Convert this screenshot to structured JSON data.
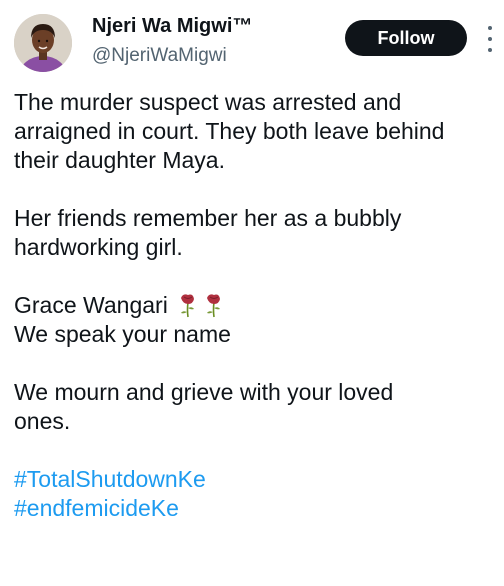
{
  "author": {
    "name": "Njeri Wa Migwi™",
    "handle": "@NjeriWaMigwi"
  },
  "follow_label": "Follow",
  "icons": {
    "avatar": "profile-photo",
    "more": "more-vertical-icon",
    "rose": "wilted-flower-emoji"
  },
  "colors": {
    "text": "#0f1419",
    "secondary": "#536471",
    "hashtag": "#1d9bf0",
    "button": "#0f1419"
  },
  "tweet": {
    "line1": "The murder suspect was arrested and",
    "line2": "arraigned in court. They both leave behind",
    "line3": "their daughter Maya.",
    "line4": "Her friends remember her as a bubbly",
    "line5": "hardworking girl.",
    "line6": "Grace Wangari",
    "line7": "We speak your name",
    "line8": "We mourn and grieve with your loved",
    "line9": "ones.",
    "hashtags": [
      "#TotalShutdownKe",
      "#endfemicideKe"
    ]
  }
}
